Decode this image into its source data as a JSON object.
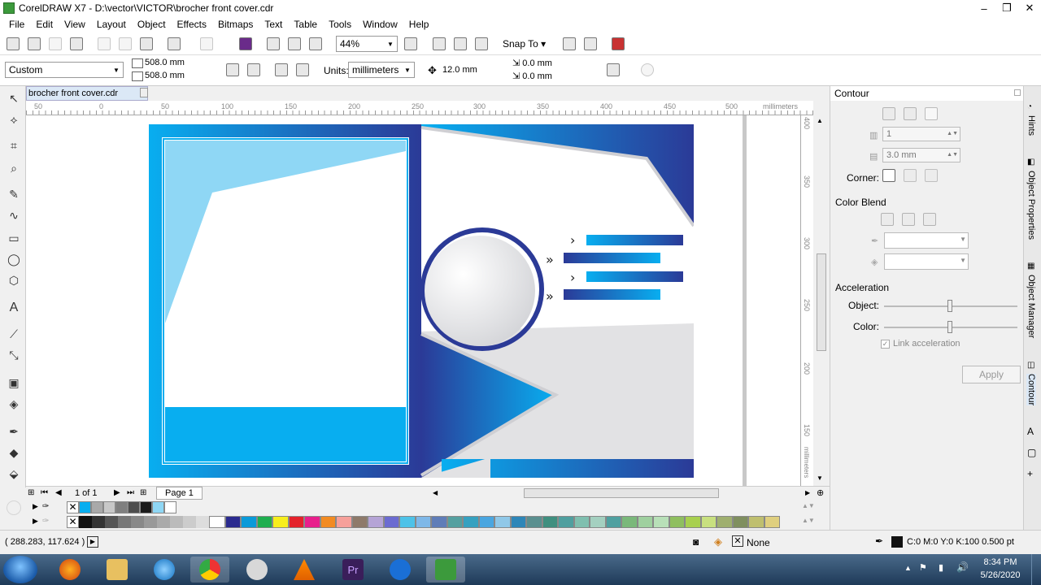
{
  "window": {
    "title": "CorelDRAW X7 - D:\\vector\\VICTOR\\brocher front cover.cdr"
  },
  "menu": [
    "File",
    "Edit",
    "View",
    "Layout",
    "Object",
    "Effects",
    "Bitmaps",
    "Text",
    "Table",
    "Tools",
    "Window",
    "Help"
  ],
  "toolbar": {
    "zoom_value": "44%",
    "snap_label": "Snap To"
  },
  "propertybar": {
    "preset": "Custom",
    "width": "508.0 mm",
    "height": "508.0 mm",
    "units_label": "Units:",
    "units_value": "millimeters",
    "nudge": "12.0 mm",
    "dup_x": "0.0 mm",
    "dup_y": "0.0 mm"
  },
  "document": {
    "tab": "brocher front cover.cdr"
  },
  "ruler": {
    "h_ticks": [
      "50",
      "0",
      "50",
      "100",
      "150",
      "200",
      "250",
      "300",
      "350",
      "400",
      "450",
      "500"
    ],
    "h_unit": "millimeters",
    "v_ticks": [
      "400",
      "350",
      "300",
      "250",
      "200",
      "150"
    ],
    "v_unit": "millimeters"
  },
  "pages": {
    "counter": "1 of 1",
    "tab": "Page 1"
  },
  "status": {
    "coords": "( 288.283, 117.624 )",
    "fill": "None",
    "outline": "C:0 M:0 Y:0 K:100  0.500 pt"
  },
  "docker": {
    "title": "Contour",
    "steps": "1",
    "offset": "3.0 mm",
    "corner_label": "Corner:",
    "color_blend_label": "Color Blend",
    "acceleration_label": "Acceleration",
    "object_label": "Object:",
    "color_label": "Color:",
    "link_label": "Link acceleration",
    "apply_label": "Apply"
  },
  "docker_tabs": [
    "Hints",
    "Object Properties",
    "Object Manager",
    "Contour"
  ],
  "clock": {
    "time": "8:34 PM",
    "date": "5/26/2020"
  },
  "colors": {
    "accent_cyan": "#08aef0",
    "navy": "#2b3a97",
    "light_blue": "#8fd7f5",
    "gray_panel": "#e2e2e4"
  },
  "doc_palette": [
    "#08aef0",
    "#a9a9a9",
    "#c8c8c8",
    "#7f7f7f",
    "#4d4d4d",
    "#1a1a1a",
    "#8fd7f5",
    "#ffffff"
  ],
  "palette": [
    "#ffffff",
    "#2b2b8f",
    "#0a9ad9",
    "#1fae4f",
    "#f7ee1d",
    "#e4222b",
    "#e81f8c",
    "#f28b22",
    "#f6a09a",
    "#8e7a6a",
    "#b5a4d6",
    "#6b6bd1",
    "#4ec2e8",
    "#7fb8e8",
    "#5f7db8",
    "#55a0a0",
    "#36a1c0",
    "#4aa6e0",
    "#90c8e8",
    "#2e86b8",
    "#5a8f8f",
    "#3f8f7f",
    "#4f9f9f",
    "#7fbfaf",
    "#a4d0c0",
    "#4fa0a0",
    "#7ab87a",
    "#9fd09f",
    "#b8e0b8",
    "#8fbf5f",
    "#a8d04f",
    "#c8e07f",
    "#9faf6f",
    "#7f8f5f",
    "#bfbf6f",
    "#dfcf7f"
  ]
}
